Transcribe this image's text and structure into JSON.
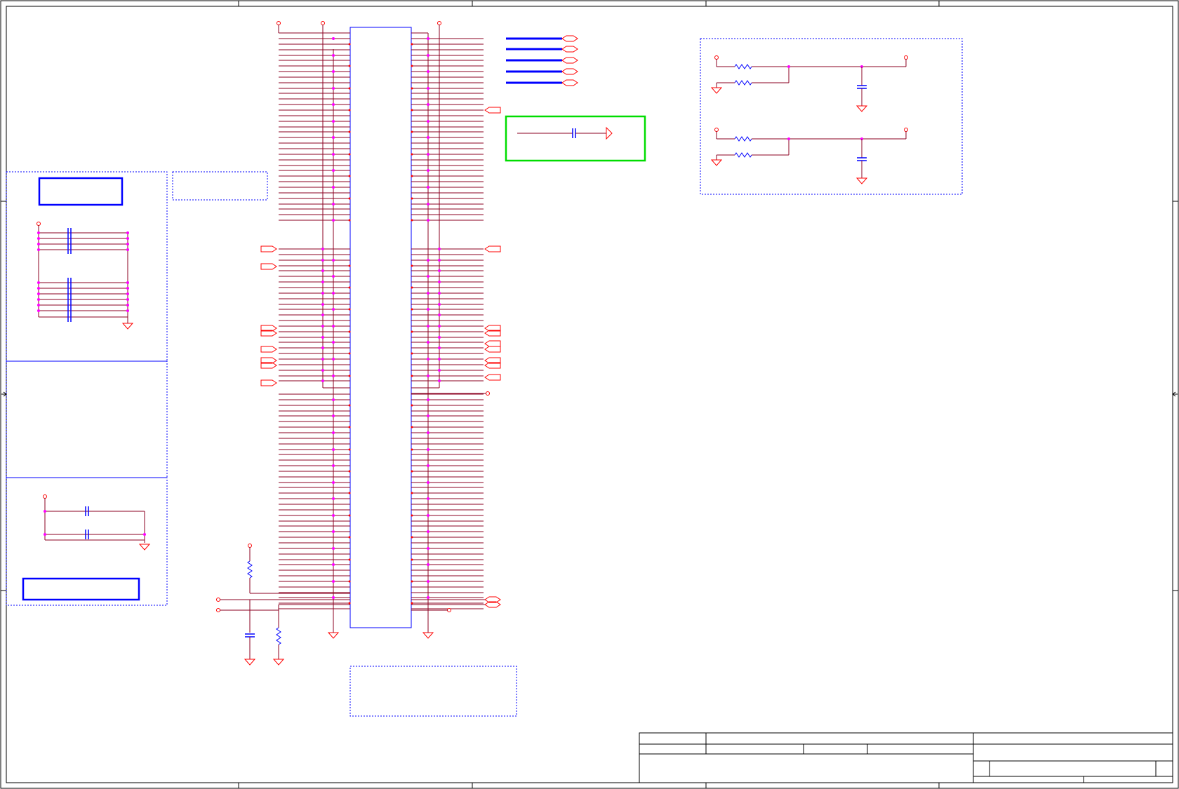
{
  "colors": {
    "frame": "#000000",
    "wire": "#8b0020",
    "component": "#ff0000",
    "pin": "#ff00ff",
    "part": "#0000ff",
    "bus": "#0000ff",
    "highlight": "#00dd00",
    "dashed": "#0000ff"
  },
  "schematic": {
    "connector": {
      "left_pin_rows": 78,
      "right_pin_rows": 78
    },
    "buses": 5,
    "divider_circuits": 2,
    "bypass_capacitor_groups": 2
  }
}
